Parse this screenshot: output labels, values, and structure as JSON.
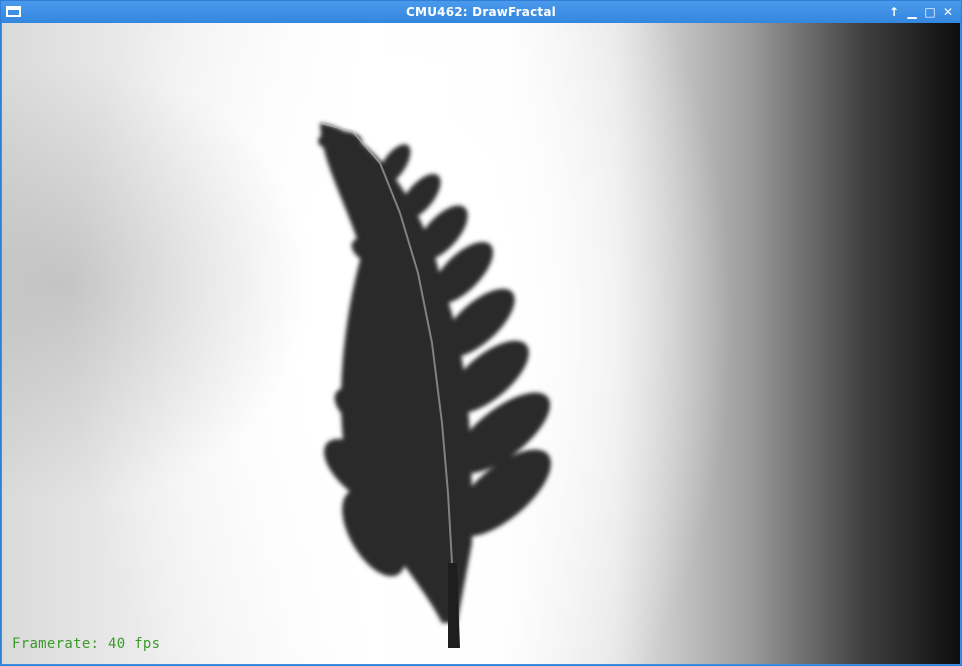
{
  "window": {
    "title": "CMU462: DrawFractal",
    "app_menu_icon": "window-menu-icon",
    "controls": {
      "shade_icon": "arrow-up-icon",
      "shade_glyph": "↑",
      "minimize_icon": "minimize-icon",
      "minimize_glyph": "▁",
      "maximize_icon": "maximize-icon",
      "maximize_glyph": "□",
      "close_icon": "close-icon",
      "close_glyph": "✕"
    }
  },
  "canvas": {
    "framerate_text": "Framerate: 40 fps",
    "framerate_color": "#3a9a2a",
    "fern_color": "#2b2b2b"
  }
}
